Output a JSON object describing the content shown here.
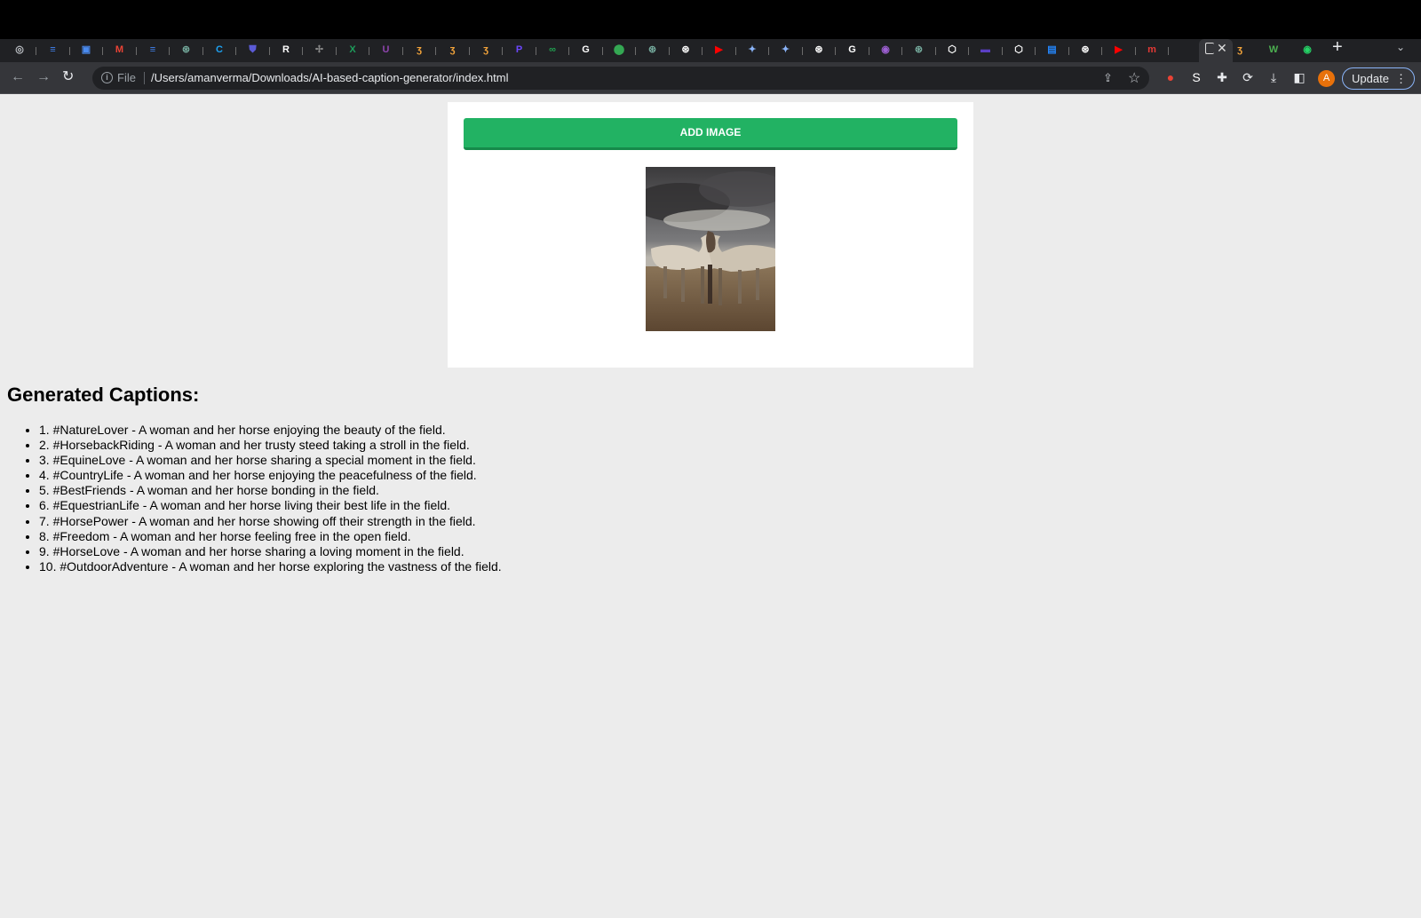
{
  "browser": {
    "address_prefix": "File",
    "url": "/Users/amanverma/Downloads/AI-based-caption-generator/index.html",
    "update_label": "Update",
    "avatar_letter": "A",
    "new_tab_symbol": "+",
    "tab_search_symbol": "⌄",
    "tabs": [
      {
        "icon": "chrome-icon",
        "glyph": "◎",
        "color": "#bdc1c6"
      },
      {
        "icon": "google-docs-icon",
        "glyph": "≡",
        "color": "#4285f4"
      },
      {
        "icon": "teams-icon",
        "glyph": "▣",
        "color": "#4a8bf0"
      },
      {
        "icon": "gmail-icon",
        "glyph": "M",
        "color": "#ea4335"
      },
      {
        "icon": "google-docs-icon",
        "glyph": "≡",
        "color": "#4285f4"
      },
      {
        "icon": "chatgpt-icon",
        "glyph": "⊛",
        "color": "#74aa9c"
      },
      {
        "icon": "canva-icon",
        "glyph": "C",
        "color": "#1da1f2"
      },
      {
        "icon": "shield-icon",
        "glyph": "⛊",
        "color": "#5b5bd6"
      },
      {
        "icon": "r-icon",
        "glyph": "R",
        "color": "#ffffff"
      },
      {
        "icon": "link-icon",
        "glyph": "✢",
        "color": "#888888"
      },
      {
        "icon": "excel-icon",
        "glyph": "X",
        "color": "#1d9d5b"
      },
      {
        "icon": "u-icon",
        "glyph": "U",
        "color": "#8e44ad"
      },
      {
        "icon": "hand-icon",
        "glyph": "ʒ",
        "color": "#f2a33a"
      },
      {
        "icon": "hand-icon",
        "glyph": "ʒ",
        "color": "#f2a33a"
      },
      {
        "icon": "hand-icon",
        "glyph": "ʒ",
        "color": "#f2a33a"
      },
      {
        "icon": "p-icon",
        "glyph": "P",
        "color": "#6c47ff"
      },
      {
        "icon": "infinity-icon",
        "glyph": "∞",
        "color": "#20a050"
      },
      {
        "icon": "google-icon",
        "glyph": "G",
        "color": "#ffffff"
      },
      {
        "icon": "maps-icon",
        "glyph": "⬤",
        "color": "#34a853"
      },
      {
        "icon": "chatgpt-icon",
        "glyph": "⊛",
        "color": "#74aa9c"
      },
      {
        "icon": "openai-icon",
        "glyph": "⊛",
        "color": "#ffffff"
      },
      {
        "icon": "youtube-icon",
        "glyph": "▶",
        "color": "#ff0000"
      },
      {
        "icon": "sparkle-icon",
        "glyph": "✦",
        "color": "#8ab4f8"
      },
      {
        "icon": "sparkle-icon",
        "glyph": "✦",
        "color": "#8ab4f8"
      },
      {
        "icon": "openai-icon",
        "glyph": "⊛",
        "color": "#ffffff"
      },
      {
        "icon": "google-icon",
        "glyph": "G",
        "color": "#ffffff"
      },
      {
        "icon": "target-icon",
        "glyph": "◉",
        "color": "#9c5fd1"
      },
      {
        "icon": "chatgpt-icon",
        "glyph": "⊛",
        "color": "#74aa9c"
      },
      {
        "icon": "codepen-icon",
        "glyph": "⬡",
        "color": "#ffffff"
      },
      {
        "icon": "coursera-icon",
        "glyph": "▬",
        "color": "#5b3fc4"
      },
      {
        "icon": "codepen-icon",
        "glyph": "⬡",
        "color": "#ffffff"
      },
      {
        "icon": "box-icon",
        "glyph": "▤",
        "color": "#2486fc"
      },
      {
        "icon": "openai-icon",
        "glyph": "⊛",
        "color": "#ffffff"
      },
      {
        "icon": "youtube-icon",
        "glyph": "▶",
        "color": "#ff0000"
      },
      {
        "icon": "my-icon",
        "glyph": "m",
        "color": "#e53935"
      }
    ],
    "tabs_after_active": [
      {
        "icon": "hand-icon",
        "glyph": "ʒ",
        "color": "#f2a33a"
      },
      {
        "icon": "w-icon",
        "glyph": "W",
        "color": "#4caf50"
      },
      {
        "icon": "whatsapp-icon",
        "glyph": "◉",
        "color": "#25d366"
      }
    ],
    "extensions": [
      {
        "icon": "record-icon",
        "glyph": "●",
        "color": "#ea4335"
      },
      {
        "icon": "s-extension-icon",
        "glyph": "S",
        "color": "#ffffff"
      },
      {
        "icon": "puzzle-icon",
        "glyph": "✚",
        "color": "#e8eaed"
      },
      {
        "icon": "sync-icon",
        "glyph": "⟳",
        "color": "#e8eaed"
      },
      {
        "icon": "download-icon",
        "glyph": "⤓",
        "color": "#e8eaed"
      },
      {
        "icon": "sidebar-icon",
        "glyph": "◧",
        "color": "#e8eaed"
      }
    ]
  },
  "page": {
    "add_image_label": "ADD IMAGE",
    "captions_heading": "Generated Captions:",
    "captions": [
      "1. #NatureLover - A woman and her horse enjoying the beauty of the field.",
      "2. #HorsebackRiding - A woman and her trusty steed taking a stroll in the field.",
      "3. #EquineLove - A woman and her horse sharing a special moment in the field.",
      "4. #CountryLife - A woman and her horse enjoying the peacefulness of the field.",
      "5. #BestFriends - A woman and her horse bonding in the field.",
      "6. #EquestrianLife - A woman and her horse living their best life in the field.",
      "7. #HorsePower - A woman and her horse showing off their strength in the field.",
      "8. #Freedom - A woman and her horse feeling free in the open field.",
      "9. #HorseLove - A woman and her horse sharing a loving moment in the field.",
      "10. #OutdoorAdventure - A woman and her horse exploring the vastness of the field."
    ]
  },
  "colors": {
    "button_green": "#22b263",
    "page_background": "#ececec",
    "toolbar": "#35363a"
  }
}
